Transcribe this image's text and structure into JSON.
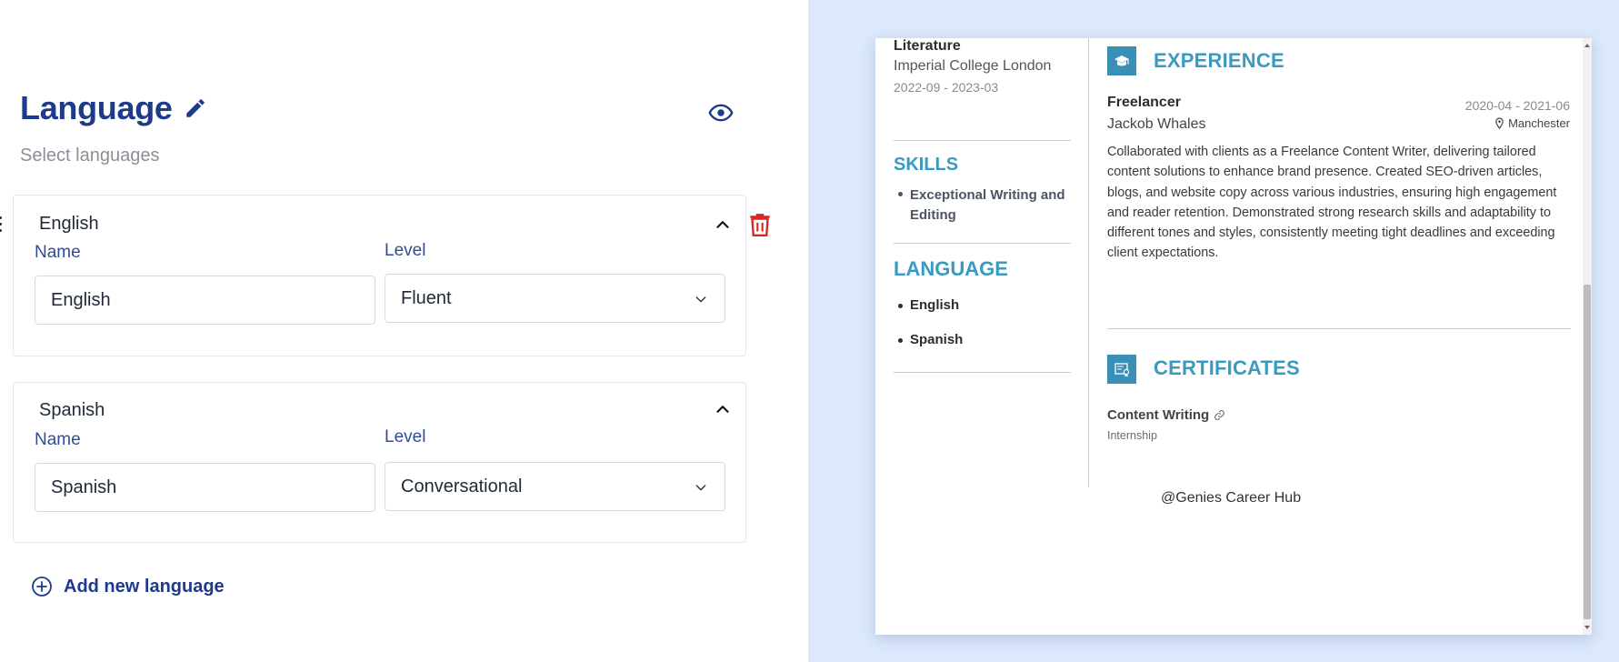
{
  "editor": {
    "title": "Language",
    "subtitle": "Select languages",
    "add_label": "Add new language",
    "languages": [
      {
        "header": "English",
        "name_label": "Name",
        "level_label": "Level",
        "name_value": "English",
        "level_value": "Fluent"
      },
      {
        "header": "Spanish",
        "name_label": "Name",
        "level_label": "Level",
        "name_value": "Spanish",
        "level_value": "Conversational"
      }
    ]
  },
  "resume": {
    "education": {
      "degree_fragment": "Literature",
      "school": "Imperial College London",
      "dates": "2022-09 - 2023-03"
    },
    "skills_title": "SKILLS",
    "skills": [
      "Exceptional Writing and Editing"
    ],
    "language_title": "LANGUAGE",
    "languages": [
      "English",
      "Spanish"
    ],
    "experience": {
      "title": "EXPERIENCE",
      "icon": "graduation-cap-icon",
      "role": "Freelancer",
      "company": "Jackob Whales",
      "dates": "2020-04 - 2021-06",
      "location": "Manchester",
      "description": "Collaborated with clients as a Freelance Content Writer, delivering tailored content solutions to enhance brand presence. Created SEO-driven articles, blogs, and website copy across various industries, ensuring high engagement and reader retention. Demonstrated strong research skills and adaptability to different tones and styles, consistently meeting tight deadlines and exceeding client expectations."
    },
    "certificates": {
      "title": "CERTIFICATES",
      "icon": "certificate-icon",
      "name": "Content Writing",
      "type": "Internship"
    },
    "footer": "@Genies Career Hub"
  },
  "colors": {
    "brand_navy": "#1e3a8a",
    "label_blue": "#2f4d97",
    "resume_accent": "#3a9ac1",
    "delete_red": "#dc2626",
    "preview_bg": "#dbe8fd"
  }
}
